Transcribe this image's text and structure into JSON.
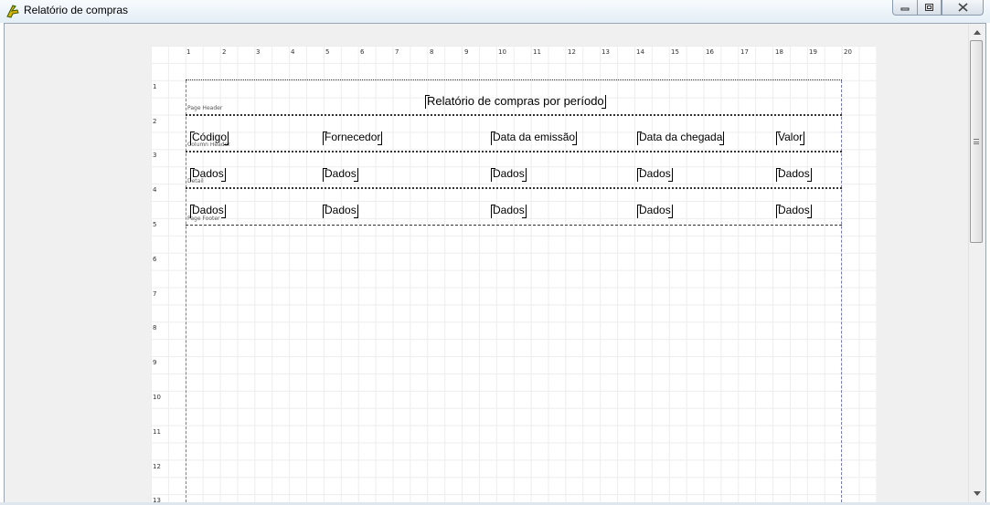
{
  "window": {
    "title": "Relatório de compras",
    "app_icon": "gecko-lizard-icon"
  },
  "ruler": {
    "top": [
      "1",
      "2",
      "3",
      "4",
      "5",
      "6",
      "7",
      "8",
      "9",
      "10",
      "11",
      "12",
      "13",
      "14",
      "15",
      "16",
      "17",
      "18",
      "19",
      "20"
    ],
    "left": [
      "1",
      "2",
      "3",
      "4",
      "5",
      "6",
      "7",
      "8",
      "9",
      "10",
      "11",
      "12",
      "13"
    ]
  },
  "report": {
    "page_header": {
      "band_label": "Page Header",
      "title": "Relatório de compras por período"
    },
    "column_header": {
      "band_label": "Column Header",
      "columns": [
        "Código",
        "Fornecedor",
        "Data da emissão",
        "Data da chegada",
        "Valor"
      ]
    },
    "detail": {
      "band_label": "Detail",
      "fields": [
        "Dados",
        "Dados",
        "Dados",
        "Dados",
        "Dados"
      ]
    },
    "page_footer": {
      "band_label": "Page Footer",
      "fields": [
        "Dados",
        "Dados",
        "Dados",
        "Dados",
        "Dados"
      ]
    }
  }
}
